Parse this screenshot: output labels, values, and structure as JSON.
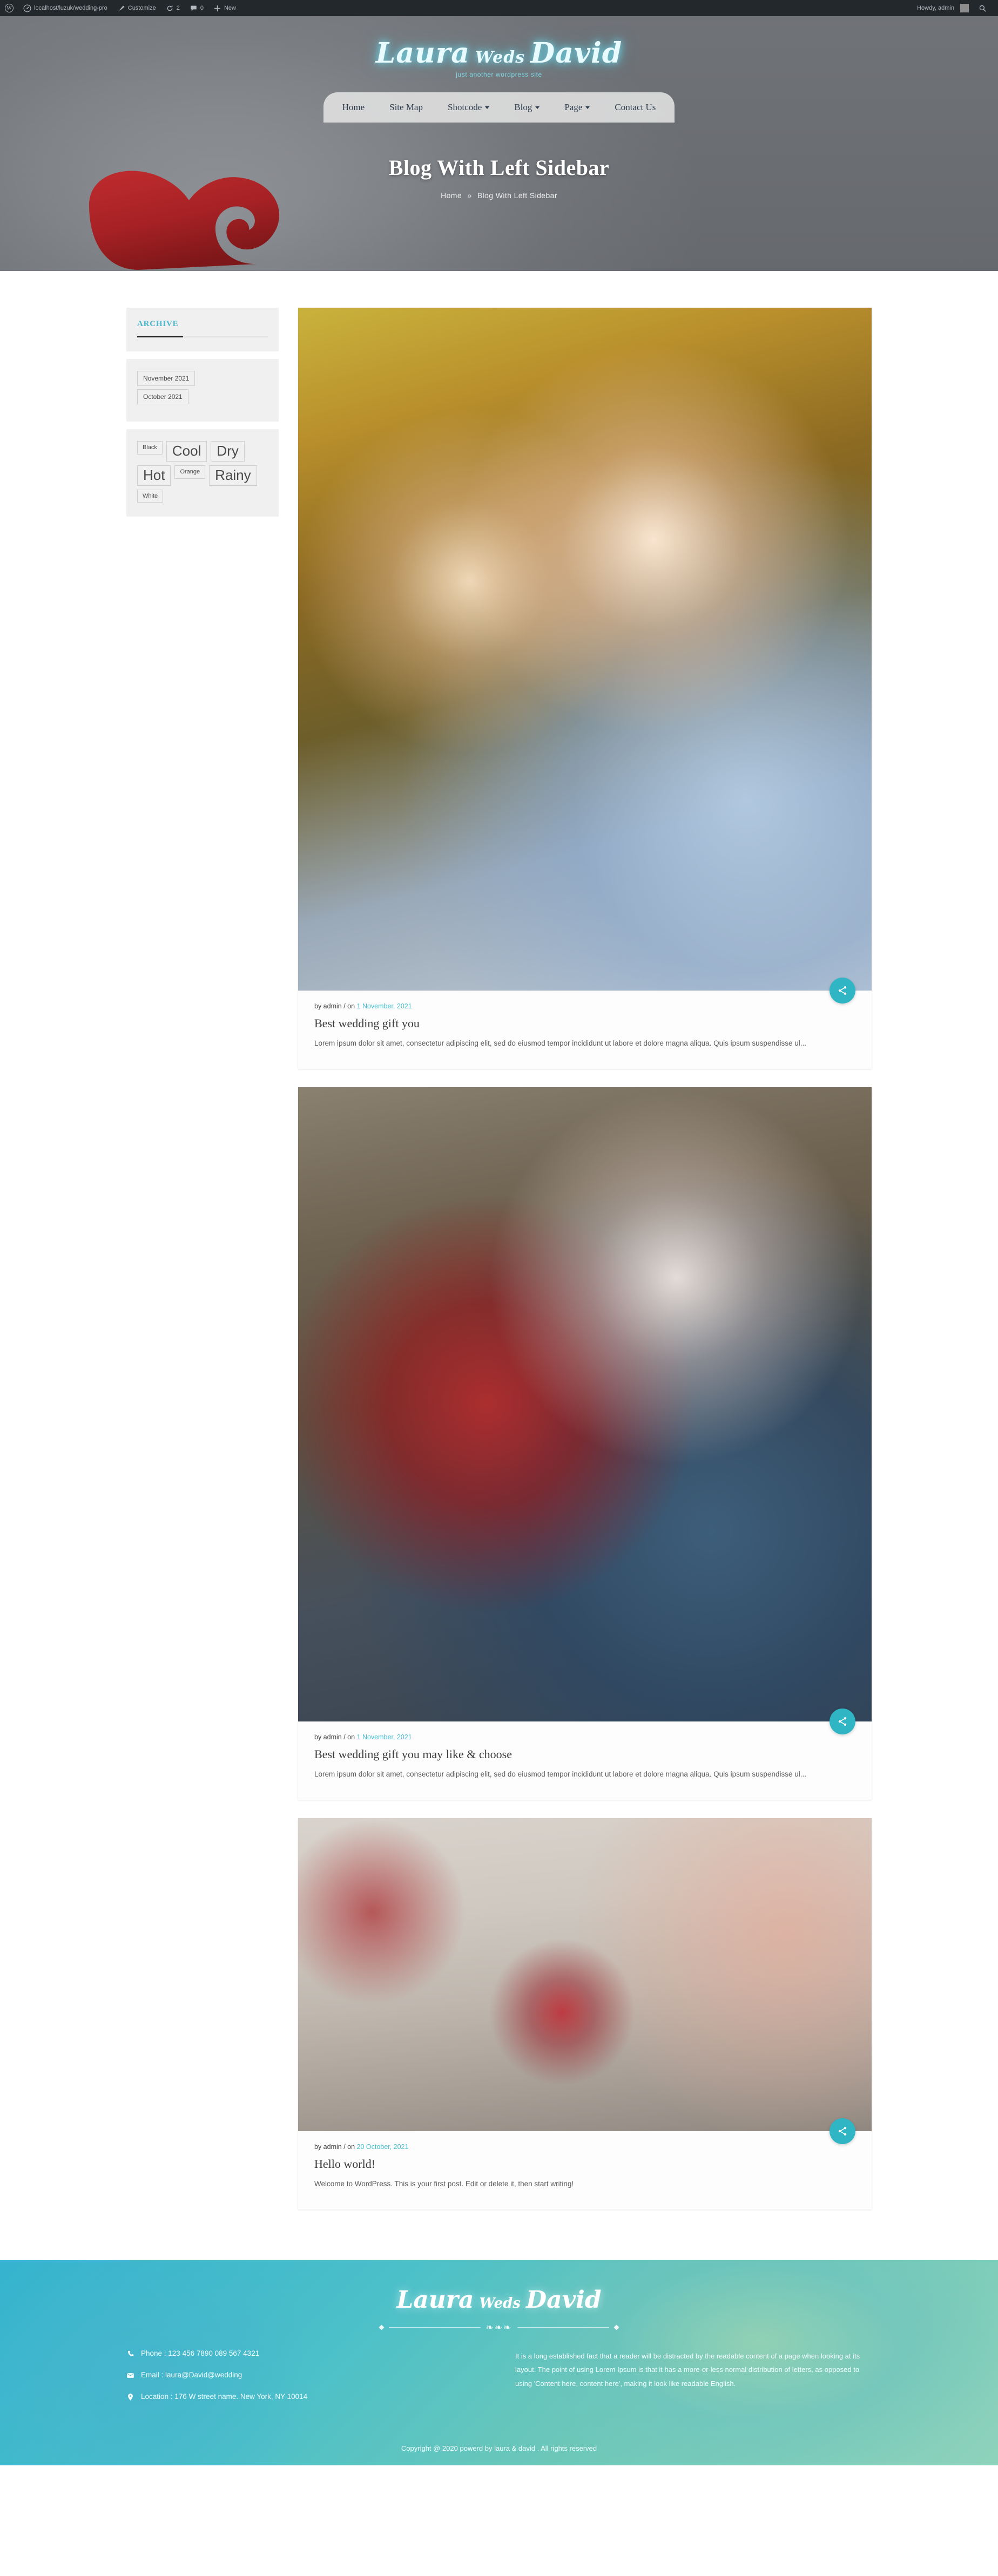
{
  "adminbar": {
    "wp_logo": "wordpress-logo-icon",
    "site_name": "localhost/luzuk/wedding-pro",
    "customize": "Customize",
    "updates_count": "2",
    "comments_count": "0",
    "new": "New",
    "howdy": "Howdy, admin",
    "search": "search-icon"
  },
  "header": {
    "site_title_1": "Laura",
    "site_title_weds": "Weds",
    "site_title_2": "David",
    "tagline": "just another wordpress site",
    "menu": [
      {
        "label": "Home",
        "has_dropdown": false
      },
      {
        "label": "Site Map",
        "has_dropdown": false
      },
      {
        "label": "Shotcode",
        "has_dropdown": true
      },
      {
        "label": "Blog",
        "has_dropdown": true
      },
      {
        "label": "Page",
        "has_dropdown": true
      },
      {
        "label": "Contact Us",
        "has_dropdown": false
      }
    ],
    "page_title": "Blog With Left Sidebar",
    "breadcrumb_home": "Home",
    "breadcrumb_sep": "»",
    "breadcrumb_current": "Blog With Left Sidebar"
  },
  "sidebar": {
    "archive_title": "ARCHIVE",
    "archives": [
      {
        "label": "November 2021"
      },
      {
        "label": "October 2021"
      }
    ],
    "tags": [
      {
        "label": "Black",
        "size": "sm"
      },
      {
        "label": "Cool",
        "size": "lg"
      },
      {
        "label": "Dry",
        "size": "lg"
      },
      {
        "label": "Hot",
        "size": "lg"
      },
      {
        "label": "Orange",
        "size": "sm"
      },
      {
        "label": "Rainy",
        "size": "lg"
      },
      {
        "label": "White",
        "size": "sm"
      }
    ]
  },
  "posts": [
    {
      "author_prefix": "by admin / on",
      "date": "1 November, 2021",
      "title": "Best wedding gift you",
      "excerpt": "Lorem ipsum dolor sit amet, consectetur adipiscing elit, sed do eiusmod tempor incididunt ut labore et dolore magna aliqua. Quis ipsum suspendisse ul...",
      "share_icon": "share-icon",
      "image_alt": "couple-autumn-photo"
    },
    {
      "author_prefix": "by admin / on",
      "date": "1 November, 2021",
      "title": "Best wedding gift you may like & choose",
      "excerpt": "Lorem ipsum dolor sit amet, consectetur adipiscing elit, sed do eiusmod tempor incididunt ut labore et dolore magna aliqua. Quis ipsum suspendisse ul...",
      "share_icon": "share-icon",
      "image_alt": "senior-couple-photo"
    },
    {
      "author_prefix": "by admin / on",
      "date": "20 October, 2021",
      "title": "Hello world!",
      "excerpt": "Welcome to WordPress. This is your first post. Edit or delete it, then start writing!",
      "share_icon": "share-icon",
      "image_alt": "wedding-table-photo"
    }
  ],
  "footer": {
    "title_1": "Laura",
    "title_weds": "Weds",
    "title_2": "David",
    "contact": [
      {
        "icon": "phone-icon",
        "text": "Phone : 123 456 7890 089 567 4321"
      },
      {
        "icon": "mail-icon",
        "text": "Email : laura@David@wedding"
      },
      {
        "icon": "location-icon",
        "text": "Location : 176 W street name. New York, NY 10014"
      }
    ],
    "about_text": "It is a long established fact that a reader will be distracted by the readable content of a page when looking at its layout. The point of using Lorem Ipsum is that it has a more-or-less normal distribution of letters, as opposed to using 'Content here, content here', making it look like readable English.",
    "copyright": "Copyright @ 2020 powerd by laura & david . All rights reserved"
  },
  "colors": {
    "accent": "#2fb5c4",
    "accent_light": "#49bdd0",
    "adminbar": "#23282d",
    "heart_red": "#b51f22"
  }
}
